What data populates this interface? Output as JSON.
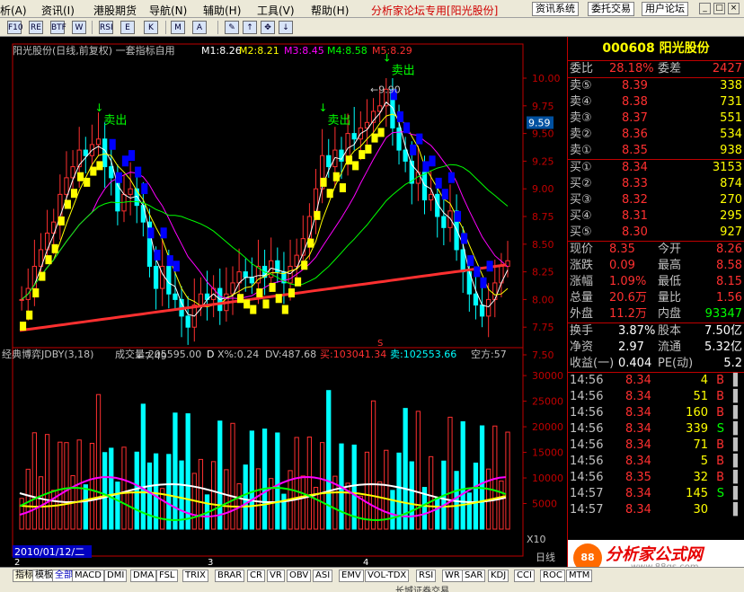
{
  "menu": {
    "items": [
      {
        "label": "析(A)"
      },
      {
        "label": "资讯(I)"
      },
      {
        "label": "港股期货"
      },
      {
        "label": "导航(N)"
      },
      {
        "label": "辅助(H)"
      },
      {
        "label": "工具(V)"
      },
      {
        "label": "帮助(H)"
      }
    ],
    "promo": "分析家论坛专用",
    "stock_tag": "[阳光股份]",
    "buttons": [
      "资讯系统",
      "委托交易",
      "用户论坛"
    ]
  },
  "toolbar": {
    "buttons": [
      "F10",
      "RE",
      "BTF",
      "W",
      "RSI",
      "E",
      "K",
      "M",
      "A"
    ]
  },
  "chart": {
    "title": "阳光股份(日线,前复权) 一套指标自用",
    "ma": [
      "M1:8.26",
      "M2:8.21",
      "M3:8.45",
      "M4:8.58",
      "M5:8.29"
    ],
    "ma_colors": [
      "#ffffff",
      "#ffff00",
      "#ff00ff",
      "#00ff00",
      "#ff3030"
    ],
    "price_axis": [
      "10.00",
      "9.75",
      "9.50",
      "9.25",
      "9.00",
      "8.75",
      "8.50",
      "8.25",
      "8.00",
      "7.75",
      "7.50"
    ],
    "price_range": [
      7.5,
      10.0
    ],
    "current_price": "9.59",
    "annotations": {
      "sell": "卖出",
      "high": "9.90",
      "low": "7.49",
      "marker": "S"
    },
    "sell_signals": [
      {
        "bar": 12,
        "price": 9.75
      },
      {
        "bar": 47,
        "price": 9.75
      },
      {
        "bar": 57,
        "price": 10.2
      }
    ],
    "indicator_header": {
      "name": "经典博弈JDBY(3,18)",
      "vol": "成交量:205595.00",
      "d": "D",
      "x": "X%:0.24",
      "dv": "DV:487.68",
      "buy": "买:103041.34",
      "sell": "卖:102553.66",
      "empty": "空方:57"
    },
    "vol_axis": [
      "30000",
      "25000",
      "20000",
      "15000",
      "10000",
      "5000"
    ],
    "x10": "X10",
    "date_label": "2010/01/12/二",
    "month_ticks": [
      "2",
      "3",
      "4"
    ],
    "tabs_end": "日线",
    "colors": {
      "up": "#ff3030",
      "down": "#00ffff",
      "ma5": "#ff3030"
    },
    "chart_data": {
      "type": "candlestick",
      "y_range": [
        7.5,
        10.0
      ],
      "high": 9.9,
      "low": 7.49,
      "close": [
        8.0,
        8.1,
        8.3,
        8.45,
        8.6,
        8.7,
        8.95,
        9.1,
        9.2,
        9.35,
        9.3,
        9.4,
        9.45,
        9.2,
        9.1,
        8.8,
        8.95,
        9.0,
        8.85,
        8.7,
        8.3,
        8.1,
        8.3,
        8.05,
        8.0,
        7.85,
        7.75,
        7.95,
        8.05,
        8.0,
        8.1,
        7.9,
        8.05,
        8.15,
        8.25,
        8.2,
        8.15,
        8.3,
        8.2,
        8.35,
        8.25,
        8.15,
        8.3,
        8.4,
        8.55,
        8.75,
        9.0,
        9.3,
        9.2,
        9.35,
        9.25,
        9.5,
        9.45,
        9.55,
        9.6,
        9.7,
        9.75,
        9.9,
        9.55,
        9.35,
        9.25,
        9.05,
        9.15,
        8.9,
        8.95,
        8.75,
        8.65,
        8.8,
        8.45,
        8.25,
        8.05,
        7.95,
        7.85,
        8.0,
        8.15,
        8.3,
        8.35
      ]
    }
  },
  "quote": {
    "title": "000608 阳光股份",
    "webi": {
      "label": "委比",
      "value": "28.18%",
      "label2": "委差",
      "value2": "2427"
    },
    "sell": [
      {
        "label": "卖⑤",
        "price": "8.39",
        "vol": "338"
      },
      {
        "label": "卖④",
        "price": "8.38",
        "vol": "731"
      },
      {
        "label": "卖③",
        "price": "8.37",
        "vol": "551"
      },
      {
        "label": "卖②",
        "price": "8.36",
        "vol": "534"
      },
      {
        "label": "卖①",
        "price": "8.35",
        "vol": "938"
      }
    ],
    "buy": [
      {
        "label": "买①",
        "price": "8.34",
        "vol": "3153"
      },
      {
        "label": "买②",
        "price": "8.33",
        "vol": "874"
      },
      {
        "label": "买③",
        "price": "8.32",
        "vol": "270"
      },
      {
        "label": "买④",
        "price": "8.31",
        "vol": "295"
      },
      {
        "label": "买⑤",
        "price": "8.30",
        "vol": "927"
      }
    ],
    "stats": [
      {
        "l1": "现价",
        "v1": "8.35",
        "l2": "今开",
        "v2": "8.26"
      },
      {
        "l1": "涨跌",
        "v1": "0.09",
        "l2": "最高",
        "v2": "8.58"
      },
      {
        "l1": "涨幅",
        "v1": "1.09%",
        "l2": "最低",
        "v2": "8.15"
      },
      {
        "l1": "总量",
        "v1": "20.6万",
        "l2": "量比",
        "v2": "1.56"
      },
      {
        "l1": "外盘",
        "v1": "11.2万",
        "l2": "内盘",
        "v2": "93347"
      }
    ],
    "stats2": [
      {
        "l1": "换手",
        "v1": "3.87%",
        "l2": "股本",
        "v2": "7.50亿"
      },
      {
        "l1": "净资",
        "v1": "2.97",
        "l2": "流通",
        "v2": "5.32亿"
      },
      {
        "l1": "收益(一)",
        "v1": "0.404",
        "l2": "PE(动)",
        "v2": "5.2"
      }
    ],
    "ticks": [
      {
        "t": "14:56",
        "p": "8.34",
        "v": "4",
        "s": "B"
      },
      {
        "t": "14:56",
        "p": "8.34",
        "v": "51",
        "s": "B"
      },
      {
        "t": "14:56",
        "p": "8.34",
        "v": "160",
        "s": "B"
      },
      {
        "t": "14:56",
        "p": "8.34",
        "v": "339",
        "s": "S"
      },
      {
        "t": "14:56",
        "p": "8.34",
        "v": "71",
        "s": "B"
      },
      {
        "t": "14:56",
        "p": "8.34",
        "v": "5",
        "s": "B"
      },
      {
        "t": "14:56",
        "p": "8.35",
        "v": "32",
        "s": "B"
      },
      {
        "t": "14:57",
        "p": "8.34",
        "v": "145",
        "s": "S"
      },
      {
        "t": "14:57",
        "p": "8.34",
        "v": "30",
        "s": ""
      }
    ]
  },
  "logo": {
    "main": "分析家公式网",
    "sub": "www.88gs.com"
  },
  "status": {
    "tabs": [
      "指标",
      "模板",
      "全部",
      "MACD",
      "DMI",
      "DMA",
      "FSL",
      "TRIX",
      "BRAR",
      "CR",
      "VR",
      "OBV",
      "ASI",
      "EMV",
      "VOL-TDX",
      "RSI",
      "WR",
      "SAR",
      "KDJ",
      "CCI",
      "ROC",
      "MTM"
    ],
    "bottom": "长城证券交易"
  }
}
